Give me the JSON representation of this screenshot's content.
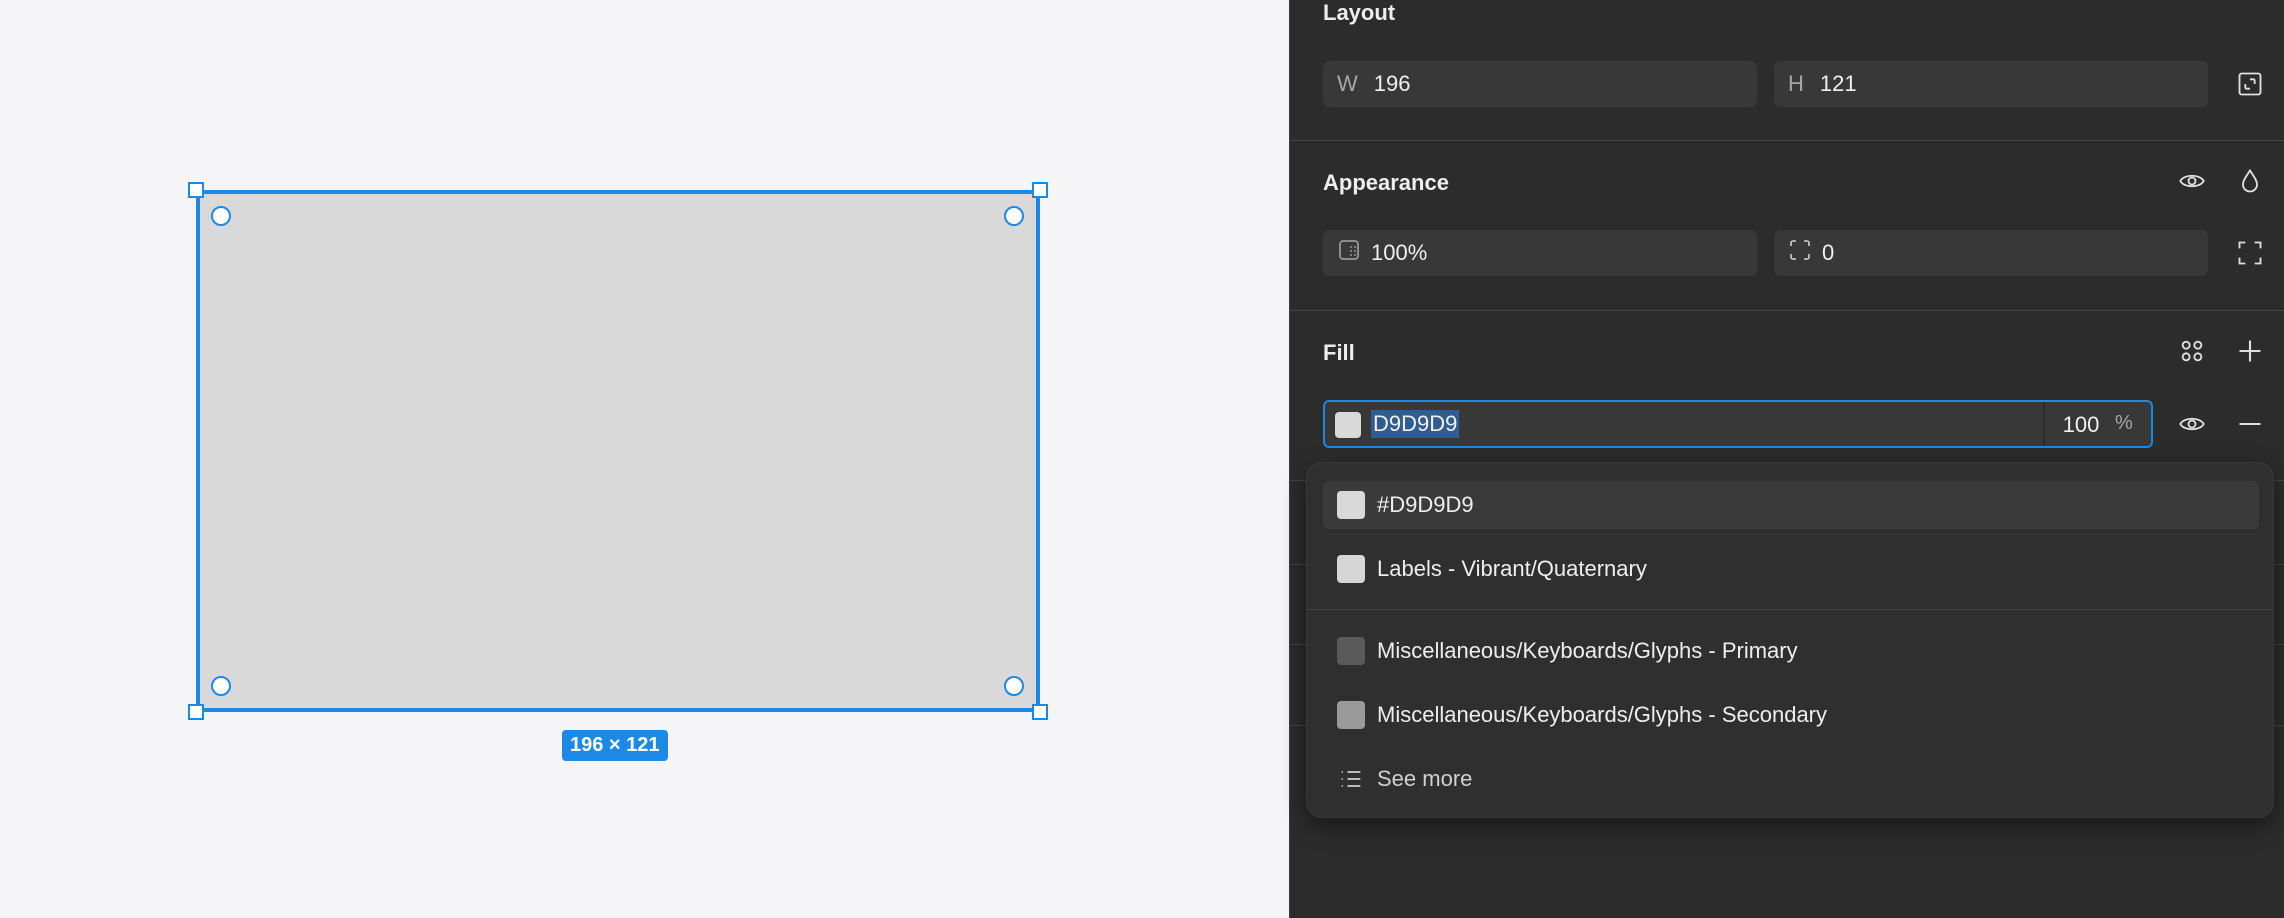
{
  "canvas": {
    "dimension_label": "196 × 121"
  },
  "layout": {
    "title": "Layout",
    "width_prefix": "W",
    "width_value": "196",
    "height_prefix": "H",
    "height_value": "121"
  },
  "appearance": {
    "title": "Appearance",
    "opacity_value": "100%",
    "radius_value": "0"
  },
  "fill": {
    "title": "Fill",
    "hex_value": "D9D9D9",
    "opacity_value": "100",
    "percent_symbol": "%",
    "swatch_color": "#d9d9d9"
  },
  "dropdown": {
    "items": [
      {
        "label": "#D9D9D9",
        "swatch": "#d9d9d9"
      },
      {
        "label": "Labels - Vibrant/Quaternary",
        "swatch": "#d6d6d6"
      },
      {
        "label": "Miscellaneous/Keyboards/Glyphs - Primary",
        "swatch": "#5a5a5a"
      },
      {
        "label": "Miscellaneous/Keyboards/Glyphs - Secondary",
        "swatch": "#9a9a9a"
      }
    ],
    "see_more": "See more"
  },
  "colors": {
    "accent": "#1e88e5",
    "panel_bg": "#2c2c2c",
    "canvas_bg": "#f5f5f7"
  }
}
